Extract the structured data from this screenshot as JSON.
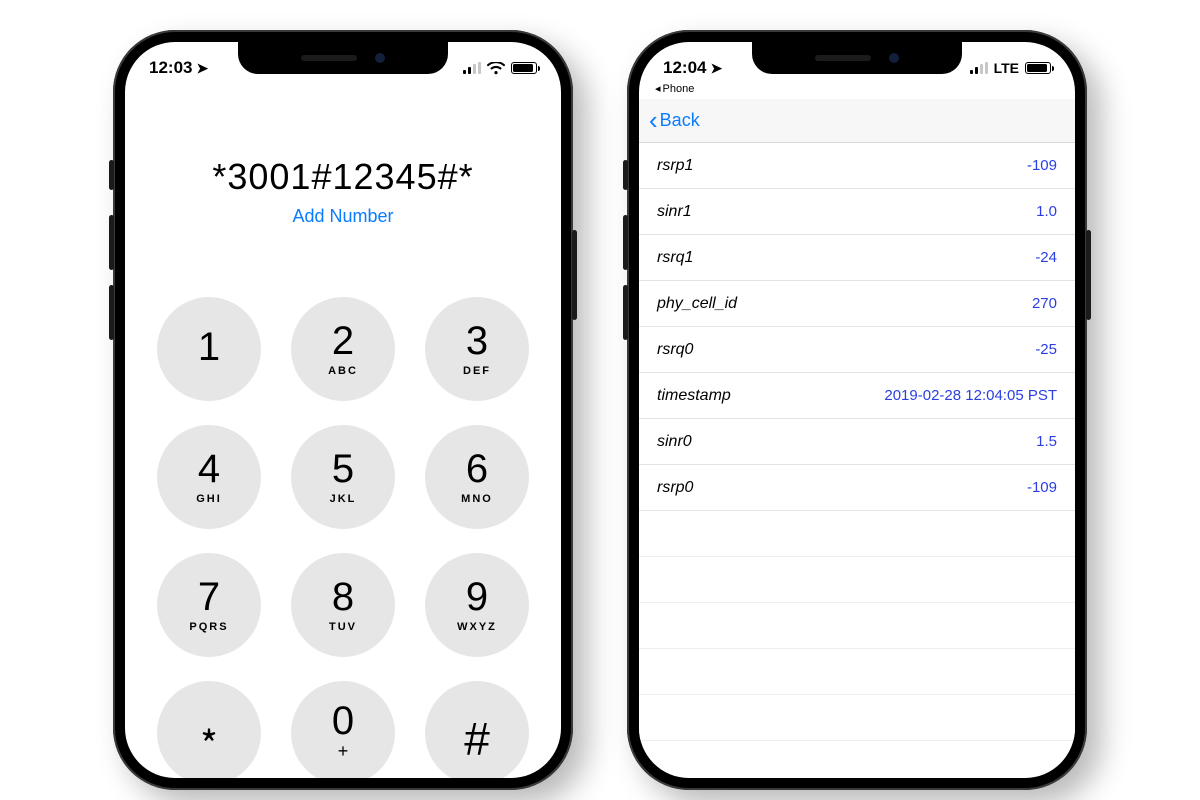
{
  "phone1": {
    "status": {
      "time": "12:03",
      "network": "wifi"
    },
    "entered_number": "*3001#12345#*",
    "add_number_label": "Add Number",
    "keypad": [
      {
        "digit": "1",
        "letters": ""
      },
      {
        "digit": "2",
        "letters": "ABC"
      },
      {
        "digit": "3",
        "letters": "DEF"
      },
      {
        "digit": "4",
        "letters": "GHI"
      },
      {
        "digit": "5",
        "letters": "JKL"
      },
      {
        "digit": "6",
        "letters": "MNO"
      },
      {
        "digit": "7",
        "letters": "PQRS"
      },
      {
        "digit": "8",
        "letters": "TUV"
      },
      {
        "digit": "9",
        "letters": "WXYZ"
      },
      {
        "digit": "﹡",
        "letters": ""
      },
      {
        "digit": "0",
        "letters": "+"
      },
      {
        "digit": "#",
        "letters": ""
      }
    ]
  },
  "phone2": {
    "status": {
      "time": "12:04",
      "network_label": "LTE"
    },
    "breadcrumb_app": "Phone",
    "back_label": "Back",
    "rows": [
      {
        "label": "rsrp1",
        "value": "-109"
      },
      {
        "label": "sinr1",
        "value": "1.0"
      },
      {
        "label": "rsrq1",
        "value": "-24"
      },
      {
        "label": "phy_cell_id",
        "value": "270"
      },
      {
        "label": "rsrq0",
        "value": "-25"
      },
      {
        "label": "timestamp",
        "value": "2019-02-28 12:04:05 PST"
      },
      {
        "label": "sinr0",
        "value": "1.5"
      },
      {
        "label": "rsrp0",
        "value": "-109"
      }
    ]
  }
}
